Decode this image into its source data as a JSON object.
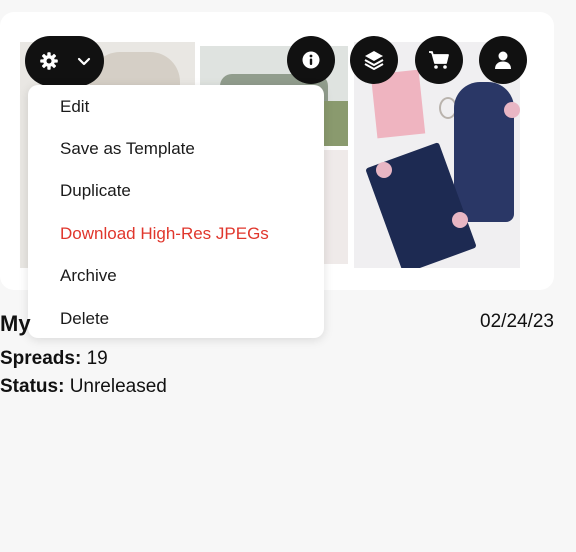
{
  "project": {
    "title": "My",
    "date": "02/24/23",
    "spreads_label": "Spreads:",
    "spreads_value": "19",
    "status_label": "Status:",
    "status_value": "Unreleased"
  },
  "toolbar": {
    "settings_icon": "gear-icon",
    "dropdown_icon": "chevron-down-icon",
    "buttons": [
      {
        "icon": "info-icon"
      },
      {
        "icon": "layers-icon"
      },
      {
        "icon": "cart-icon"
      },
      {
        "icon": "user-icon"
      }
    ]
  },
  "menu": {
    "items": [
      {
        "label": "Edit"
      },
      {
        "label": "Save as Template"
      },
      {
        "label": "Duplicate"
      },
      {
        "label": "Download High-Res JPEGs",
        "color": "#e0362c"
      },
      {
        "label": "Archive"
      },
      {
        "label": "Delete"
      }
    ]
  },
  "colors": {
    "button_bg": "#111111",
    "accent_danger": "#e0362c",
    "card_bg": "#ffffff",
    "page_bg": "#f7f7f7"
  }
}
